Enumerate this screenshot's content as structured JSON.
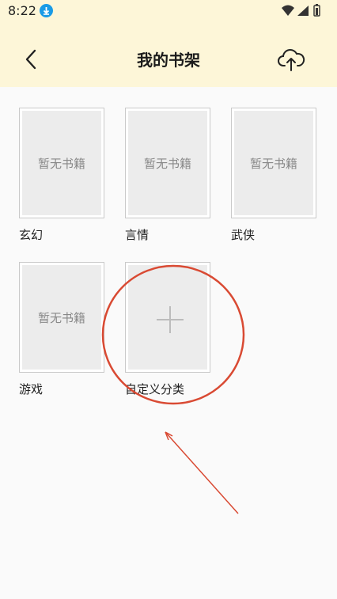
{
  "status_bar": {
    "time": "8:22"
  },
  "toolbar": {
    "title": "我的书架"
  },
  "shelves": [
    {
      "label": "玄幻",
      "placeholder": "暂无书籍"
    },
    {
      "label": "言情",
      "placeholder": "暂无书籍"
    },
    {
      "label": "武侠",
      "placeholder": "暂无书籍"
    },
    {
      "label": "游戏",
      "placeholder": "暂无书籍"
    }
  ],
  "custom_category": {
    "label": "自定义分类"
  },
  "colors": {
    "header_bg": "#fdf6d8",
    "annotation": "#d94a33",
    "download_badge": "#1a9be6"
  }
}
